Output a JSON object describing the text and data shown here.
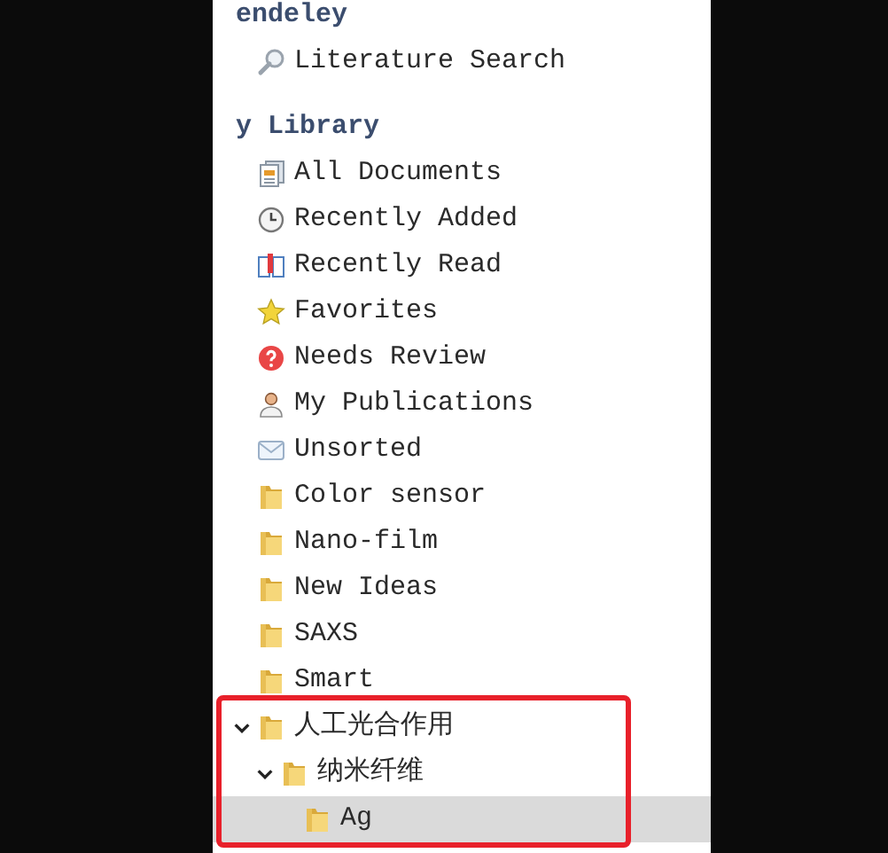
{
  "sections": [
    {
      "title": "endeley",
      "items": [
        {
          "kind": "search",
          "label": "Literature Search",
          "selected": false
        }
      ]
    },
    {
      "title": "y Library",
      "items": [
        {
          "kind": "documents",
          "label": "All Documents",
          "selected": false
        },
        {
          "kind": "clock",
          "label": "Recently Added",
          "selected": false
        },
        {
          "kind": "book",
          "label": "Recently Read",
          "selected": false
        },
        {
          "kind": "star",
          "label": "Favorites",
          "selected": false
        },
        {
          "kind": "question",
          "label": "Needs Review",
          "selected": false
        },
        {
          "kind": "person",
          "label": "My Publications",
          "selected": false
        },
        {
          "kind": "envelope",
          "label": "Unsorted",
          "selected": false
        },
        {
          "kind": "folder",
          "label": "Color sensor",
          "selected": false
        },
        {
          "kind": "folder",
          "label": "Nano-film",
          "selected": false
        },
        {
          "kind": "folder",
          "label": "New Ideas",
          "selected": false
        },
        {
          "kind": "folder",
          "label": "SAXS",
          "selected": false
        },
        {
          "kind": "folder",
          "label": "Smart",
          "selected": false
        },
        {
          "kind": "folder",
          "label": "人工光合作用",
          "selected": false,
          "expanded": true,
          "children": [
            {
              "kind": "folder",
              "label": "纳米纤维",
              "selected": false,
              "expanded": true,
              "children": [
                {
                  "kind": "folder",
                  "label": "Ag",
                  "selected": true
                }
              ]
            }
          ]
        }
      ]
    }
  ]
}
